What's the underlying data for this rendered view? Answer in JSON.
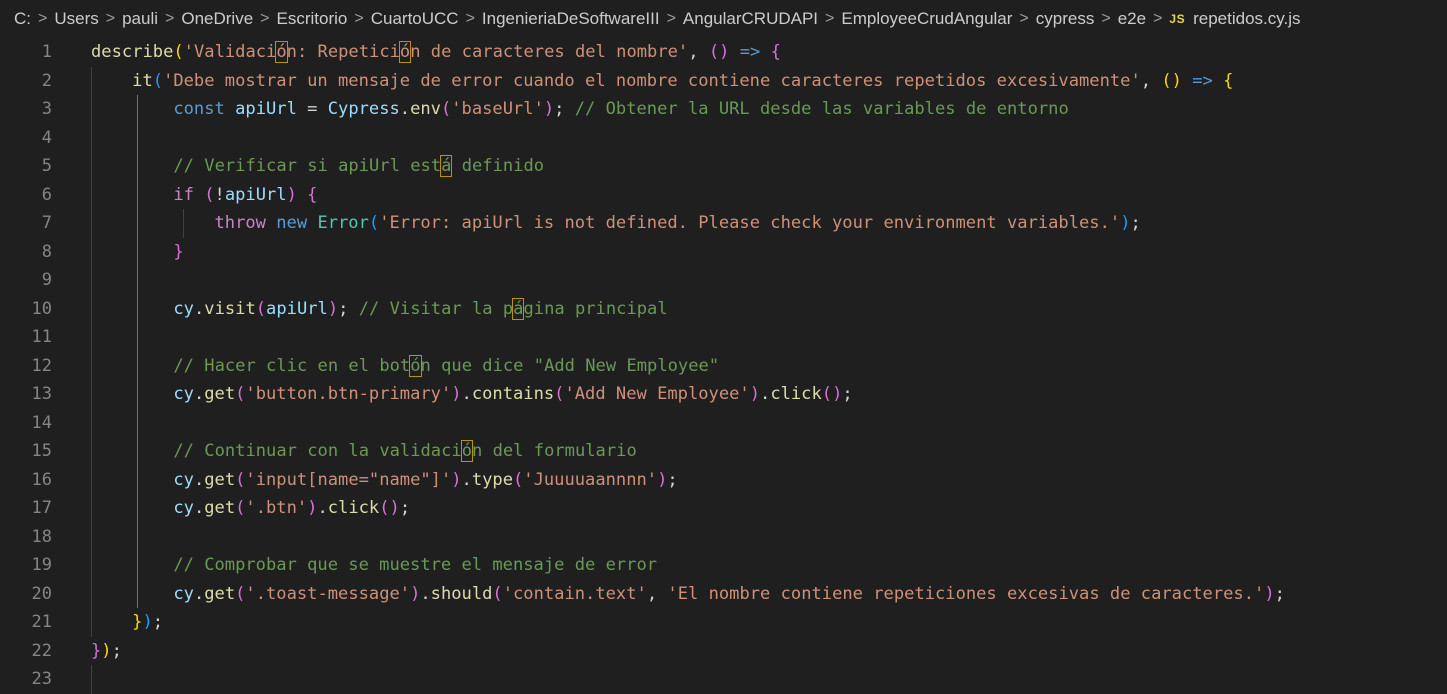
{
  "breadcrumb": {
    "items": [
      "C:",
      "Users",
      "pauli",
      "OneDrive",
      "Escritorio",
      "CuartoUCC",
      "IngenieriaDeSoftwareIII",
      "AngularCRUDAPI",
      "EmployeeCrudAngular",
      "cypress",
      "e2e"
    ],
    "file_badge": "JS",
    "file_name": "repetidos.cy.js",
    "separator": ">"
  },
  "editor": {
    "language": "javascript",
    "lines": [
      {
        "n": "1",
        "t": [
          [
            "describe",
            "fn"
          ],
          [
            "(",
            "b1"
          ],
          [
            "'Validación: Repetición de caracteres del nombre'",
            "s"
          ],
          [
            ", ",
            "op"
          ],
          [
            "()",
            "b2"
          ],
          [
            " ",
            "op"
          ],
          [
            "=>",
            "k"
          ],
          [
            " ",
            "op"
          ],
          [
            "{",
            "b2"
          ]
        ]
      },
      {
        "n": "2",
        "t": [
          [
            "    ",
            "op"
          ],
          [
            "it",
            "fn"
          ],
          [
            "(",
            "b3"
          ],
          [
            "'Debe mostrar un mensaje de error cuando el nombre contiene caracteres repetidos excesivamente'",
            "s"
          ],
          [
            ", ",
            "op"
          ],
          [
            "()",
            "b1"
          ],
          [
            " ",
            "op"
          ],
          [
            "=>",
            "k"
          ],
          [
            " ",
            "op"
          ],
          [
            "{",
            "b1"
          ]
        ]
      },
      {
        "n": "3",
        "t": [
          [
            "        ",
            "op"
          ],
          [
            "const",
            "k"
          ],
          [
            " ",
            "op"
          ],
          [
            "apiUrl",
            "v"
          ],
          [
            " = ",
            "op"
          ],
          [
            "Cypress",
            "v"
          ],
          [
            ".",
            "op"
          ],
          [
            "env",
            "fn"
          ],
          [
            "(",
            "b2"
          ],
          [
            "'baseUrl'",
            "s"
          ],
          [
            ")",
            "b2"
          ],
          [
            "; ",
            "op"
          ],
          [
            "// Obtener la URL desde las variables de entorno",
            "c"
          ]
        ]
      },
      {
        "n": "4",
        "t": []
      },
      {
        "n": "5",
        "t": [
          [
            "        ",
            "op"
          ],
          [
            "// Verificar si apiUrl está definido",
            "c"
          ]
        ]
      },
      {
        "n": "6",
        "t": [
          [
            "        ",
            "op"
          ],
          [
            "if",
            "ctl"
          ],
          [
            " ",
            "op"
          ],
          [
            "(",
            "b2"
          ],
          [
            "!",
            "op"
          ],
          [
            "apiUrl",
            "v"
          ],
          [
            ")",
            "b2"
          ],
          [
            " ",
            "op"
          ],
          [
            "{",
            "b2"
          ]
        ]
      },
      {
        "n": "7",
        "t": [
          [
            "            ",
            "op"
          ],
          [
            "throw",
            "ctl"
          ],
          [
            " ",
            "op"
          ],
          [
            "new",
            "k"
          ],
          [
            " ",
            "op"
          ],
          [
            "Error",
            "cls"
          ],
          [
            "(",
            "b3"
          ],
          [
            "'Error: apiUrl is not defined. Please check your environment variables.'",
            "s"
          ],
          [
            ")",
            "b3"
          ],
          [
            ";",
            "op"
          ]
        ]
      },
      {
        "n": "8",
        "t": [
          [
            "        ",
            "op"
          ],
          [
            "}",
            "b2"
          ]
        ]
      },
      {
        "n": "9",
        "t": []
      },
      {
        "n": "10",
        "t": [
          [
            "        ",
            "op"
          ],
          [
            "cy",
            "v"
          ],
          [
            ".",
            "op"
          ],
          [
            "visit",
            "fn"
          ],
          [
            "(",
            "b2"
          ],
          [
            "apiUrl",
            "v"
          ],
          [
            ")",
            "b2"
          ],
          [
            "; ",
            "op"
          ],
          [
            "// Visitar la página principal",
            "c"
          ]
        ]
      },
      {
        "n": "11",
        "t": []
      },
      {
        "n": "12",
        "t": [
          [
            "        ",
            "op"
          ],
          [
            "// Hacer clic en el botón que dice \"Add New Employee\"",
            "c"
          ]
        ]
      },
      {
        "n": "13",
        "t": [
          [
            "        ",
            "op"
          ],
          [
            "cy",
            "v"
          ],
          [
            ".",
            "op"
          ],
          [
            "get",
            "fn"
          ],
          [
            "(",
            "b2"
          ],
          [
            "'button.btn-primary'",
            "s"
          ],
          [
            ")",
            "b2"
          ],
          [
            ".",
            "op"
          ],
          [
            "contains",
            "fn"
          ],
          [
            "(",
            "b2"
          ],
          [
            "'Add New Employee'",
            "s"
          ],
          [
            ")",
            "b2"
          ],
          [
            ".",
            "op"
          ],
          [
            "click",
            "fn"
          ],
          [
            "()",
            "b2"
          ],
          [
            ";",
            "op"
          ]
        ]
      },
      {
        "n": "14",
        "t": []
      },
      {
        "n": "15",
        "t": [
          [
            "        ",
            "op"
          ],
          [
            "// Continuar con la validación del formulario",
            "c"
          ]
        ]
      },
      {
        "n": "16",
        "t": [
          [
            "        ",
            "op"
          ],
          [
            "cy",
            "v"
          ],
          [
            ".",
            "op"
          ],
          [
            "get",
            "fn"
          ],
          [
            "(",
            "b2"
          ],
          [
            "'input[name=\"name\"]'",
            "s"
          ],
          [
            ")",
            "b2"
          ],
          [
            ".",
            "op"
          ],
          [
            "type",
            "fn"
          ],
          [
            "(",
            "b2"
          ],
          [
            "'Juuuuaannnn'",
            "s"
          ],
          [
            ")",
            "b2"
          ],
          [
            ";",
            "op"
          ]
        ]
      },
      {
        "n": "17",
        "t": [
          [
            "        ",
            "op"
          ],
          [
            "cy",
            "v"
          ],
          [
            ".",
            "op"
          ],
          [
            "get",
            "fn"
          ],
          [
            "(",
            "b2"
          ],
          [
            "'.btn'",
            "s"
          ],
          [
            ")",
            "b2"
          ],
          [
            ".",
            "op"
          ],
          [
            "click",
            "fn"
          ],
          [
            "()",
            "b2"
          ],
          [
            ";",
            "op"
          ]
        ]
      },
      {
        "n": "18",
        "t": []
      },
      {
        "n": "19",
        "t": [
          [
            "        ",
            "op"
          ],
          [
            "// Comprobar que se muestre el mensaje de error",
            "c"
          ]
        ]
      },
      {
        "n": "20",
        "t": [
          [
            "        ",
            "op"
          ],
          [
            "cy",
            "v"
          ],
          [
            ".",
            "op"
          ],
          [
            "get",
            "fn"
          ],
          [
            "(",
            "b2"
          ],
          [
            "'.toast-message'",
            "s"
          ],
          [
            ")",
            "b2"
          ],
          [
            ".",
            "op"
          ],
          [
            "should",
            "fn"
          ],
          [
            "(",
            "b2"
          ],
          [
            "'contain.text'",
            "s"
          ],
          [
            ", ",
            "op"
          ],
          [
            "'El nombre contiene repeticiones excesivas de caracteres.'",
            "s"
          ],
          [
            ")",
            "b2"
          ],
          [
            ";",
            "op"
          ]
        ]
      },
      {
        "n": "21",
        "t": [
          [
            "    ",
            "op"
          ],
          [
            "}",
            "b1"
          ],
          [
            ")",
            "b3"
          ],
          [
            ";",
            "op"
          ]
        ]
      },
      {
        "n": "22",
        "t": [
          [
            "}",
            "b2"
          ],
          [
            ")",
            "b1"
          ],
          [
            ";",
            "op"
          ]
        ]
      },
      {
        "n": "23",
        "t": []
      }
    ],
    "highlighted_chars": [
      {
        "line": 1,
        "text": "ó",
        "occurrence": 1
      },
      {
        "line": 1,
        "text": "ó",
        "occurrence": 2
      },
      {
        "line": 5,
        "text": "á",
        "occurrence": 1
      },
      {
        "line": 10,
        "text": "á",
        "occurrence": 1
      },
      {
        "line": 12,
        "text": "ó",
        "occurrence": 1
      },
      {
        "line": 15,
        "text": "ó",
        "occurrence": 1
      }
    ]
  }
}
